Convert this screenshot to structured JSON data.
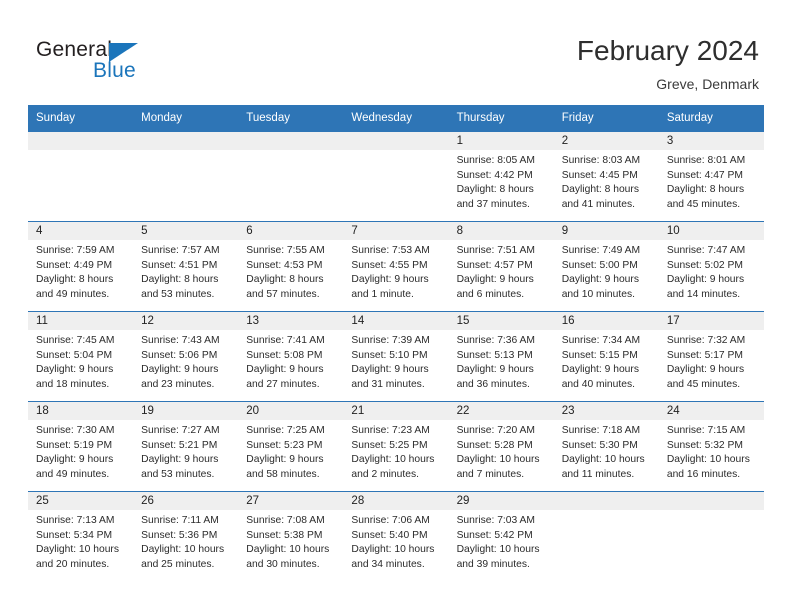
{
  "brand": {
    "name_part1": "General",
    "name_part2": "Blue",
    "accent_color": "#1b75bb"
  },
  "header": {
    "title": "February 2024",
    "location": "Greve, Denmark",
    "header_bg_color": "#2e75b6"
  },
  "weekday_headers": [
    "Sunday",
    "Monday",
    "Tuesday",
    "Wednesday",
    "Thursday",
    "Friday",
    "Saturday"
  ],
  "weeks": [
    [
      {
        "day": "",
        "sunrise": "",
        "sunset": "",
        "daylight_line1": "",
        "daylight_line2": "",
        "empty": true
      },
      {
        "day": "",
        "sunrise": "",
        "sunset": "",
        "daylight_line1": "",
        "daylight_line2": "",
        "empty": true
      },
      {
        "day": "",
        "sunrise": "",
        "sunset": "",
        "daylight_line1": "",
        "daylight_line2": "",
        "empty": true
      },
      {
        "day": "",
        "sunrise": "",
        "sunset": "",
        "daylight_line1": "",
        "daylight_line2": "",
        "empty": true
      },
      {
        "day": "1",
        "sunrise": "Sunrise: 8:05 AM",
        "sunset": "Sunset: 4:42 PM",
        "daylight_line1": "Daylight: 8 hours",
        "daylight_line2": "and 37 minutes.",
        "empty": false
      },
      {
        "day": "2",
        "sunrise": "Sunrise: 8:03 AM",
        "sunset": "Sunset: 4:45 PM",
        "daylight_line1": "Daylight: 8 hours",
        "daylight_line2": "and 41 minutes.",
        "empty": false
      },
      {
        "day": "3",
        "sunrise": "Sunrise: 8:01 AM",
        "sunset": "Sunset: 4:47 PM",
        "daylight_line1": "Daylight: 8 hours",
        "daylight_line2": "and 45 minutes.",
        "empty": false
      }
    ],
    [
      {
        "day": "4",
        "sunrise": "Sunrise: 7:59 AM",
        "sunset": "Sunset: 4:49 PM",
        "daylight_line1": "Daylight: 8 hours",
        "daylight_line2": "and 49 minutes.",
        "empty": false
      },
      {
        "day": "5",
        "sunrise": "Sunrise: 7:57 AM",
        "sunset": "Sunset: 4:51 PM",
        "daylight_line1": "Daylight: 8 hours",
        "daylight_line2": "and 53 minutes.",
        "empty": false
      },
      {
        "day": "6",
        "sunrise": "Sunrise: 7:55 AM",
        "sunset": "Sunset: 4:53 PM",
        "daylight_line1": "Daylight: 8 hours",
        "daylight_line2": "and 57 minutes.",
        "empty": false
      },
      {
        "day": "7",
        "sunrise": "Sunrise: 7:53 AM",
        "sunset": "Sunset: 4:55 PM",
        "daylight_line1": "Daylight: 9 hours",
        "daylight_line2": "and 1 minute.",
        "empty": false
      },
      {
        "day": "8",
        "sunrise": "Sunrise: 7:51 AM",
        "sunset": "Sunset: 4:57 PM",
        "daylight_line1": "Daylight: 9 hours",
        "daylight_line2": "and 6 minutes.",
        "empty": false
      },
      {
        "day": "9",
        "sunrise": "Sunrise: 7:49 AM",
        "sunset": "Sunset: 5:00 PM",
        "daylight_line1": "Daylight: 9 hours",
        "daylight_line2": "and 10 minutes.",
        "empty": false
      },
      {
        "day": "10",
        "sunrise": "Sunrise: 7:47 AM",
        "sunset": "Sunset: 5:02 PM",
        "daylight_line1": "Daylight: 9 hours",
        "daylight_line2": "and 14 minutes.",
        "empty": false
      }
    ],
    [
      {
        "day": "11",
        "sunrise": "Sunrise: 7:45 AM",
        "sunset": "Sunset: 5:04 PM",
        "daylight_line1": "Daylight: 9 hours",
        "daylight_line2": "and 18 minutes.",
        "empty": false
      },
      {
        "day": "12",
        "sunrise": "Sunrise: 7:43 AM",
        "sunset": "Sunset: 5:06 PM",
        "daylight_line1": "Daylight: 9 hours",
        "daylight_line2": "and 23 minutes.",
        "empty": false
      },
      {
        "day": "13",
        "sunrise": "Sunrise: 7:41 AM",
        "sunset": "Sunset: 5:08 PM",
        "daylight_line1": "Daylight: 9 hours",
        "daylight_line2": "and 27 minutes.",
        "empty": false
      },
      {
        "day": "14",
        "sunrise": "Sunrise: 7:39 AM",
        "sunset": "Sunset: 5:10 PM",
        "daylight_line1": "Daylight: 9 hours",
        "daylight_line2": "and 31 minutes.",
        "empty": false
      },
      {
        "day": "15",
        "sunrise": "Sunrise: 7:36 AM",
        "sunset": "Sunset: 5:13 PM",
        "daylight_line1": "Daylight: 9 hours",
        "daylight_line2": "and 36 minutes.",
        "empty": false
      },
      {
        "day": "16",
        "sunrise": "Sunrise: 7:34 AM",
        "sunset": "Sunset: 5:15 PM",
        "daylight_line1": "Daylight: 9 hours",
        "daylight_line2": "and 40 minutes.",
        "empty": false
      },
      {
        "day": "17",
        "sunrise": "Sunrise: 7:32 AM",
        "sunset": "Sunset: 5:17 PM",
        "daylight_line1": "Daylight: 9 hours",
        "daylight_line2": "and 45 minutes.",
        "empty": false
      }
    ],
    [
      {
        "day": "18",
        "sunrise": "Sunrise: 7:30 AM",
        "sunset": "Sunset: 5:19 PM",
        "daylight_line1": "Daylight: 9 hours",
        "daylight_line2": "and 49 minutes.",
        "empty": false
      },
      {
        "day": "19",
        "sunrise": "Sunrise: 7:27 AM",
        "sunset": "Sunset: 5:21 PM",
        "daylight_line1": "Daylight: 9 hours",
        "daylight_line2": "and 53 minutes.",
        "empty": false
      },
      {
        "day": "20",
        "sunrise": "Sunrise: 7:25 AM",
        "sunset": "Sunset: 5:23 PM",
        "daylight_line1": "Daylight: 9 hours",
        "daylight_line2": "and 58 minutes.",
        "empty": false
      },
      {
        "day": "21",
        "sunrise": "Sunrise: 7:23 AM",
        "sunset": "Sunset: 5:25 PM",
        "daylight_line1": "Daylight: 10 hours",
        "daylight_line2": "and 2 minutes.",
        "empty": false
      },
      {
        "day": "22",
        "sunrise": "Sunrise: 7:20 AM",
        "sunset": "Sunset: 5:28 PM",
        "daylight_line1": "Daylight: 10 hours",
        "daylight_line2": "and 7 minutes.",
        "empty": false
      },
      {
        "day": "23",
        "sunrise": "Sunrise: 7:18 AM",
        "sunset": "Sunset: 5:30 PM",
        "daylight_line1": "Daylight: 10 hours",
        "daylight_line2": "and 11 minutes.",
        "empty": false
      },
      {
        "day": "24",
        "sunrise": "Sunrise: 7:15 AM",
        "sunset": "Sunset: 5:32 PM",
        "daylight_line1": "Daylight: 10 hours",
        "daylight_line2": "and 16 minutes.",
        "empty": false
      }
    ],
    [
      {
        "day": "25",
        "sunrise": "Sunrise: 7:13 AM",
        "sunset": "Sunset: 5:34 PM",
        "daylight_line1": "Daylight: 10 hours",
        "daylight_line2": "and 20 minutes.",
        "empty": false
      },
      {
        "day": "26",
        "sunrise": "Sunrise: 7:11 AM",
        "sunset": "Sunset: 5:36 PM",
        "daylight_line1": "Daylight: 10 hours",
        "daylight_line2": "and 25 minutes.",
        "empty": false
      },
      {
        "day": "27",
        "sunrise": "Sunrise: 7:08 AM",
        "sunset": "Sunset: 5:38 PM",
        "daylight_line1": "Daylight: 10 hours",
        "daylight_line2": "and 30 minutes.",
        "empty": false
      },
      {
        "day": "28",
        "sunrise": "Sunrise: 7:06 AM",
        "sunset": "Sunset: 5:40 PM",
        "daylight_line1": "Daylight: 10 hours",
        "daylight_line2": "and 34 minutes.",
        "empty": false
      },
      {
        "day": "29",
        "sunrise": "Sunrise: 7:03 AM",
        "sunset": "Sunset: 5:42 PM",
        "daylight_line1": "Daylight: 10 hours",
        "daylight_line2": "and 39 minutes.",
        "empty": false
      },
      {
        "day": "",
        "sunrise": "",
        "sunset": "",
        "daylight_line1": "",
        "daylight_line2": "",
        "empty": true
      },
      {
        "day": "",
        "sunrise": "",
        "sunset": "",
        "daylight_line1": "",
        "daylight_line2": "",
        "empty": true
      }
    ]
  ]
}
